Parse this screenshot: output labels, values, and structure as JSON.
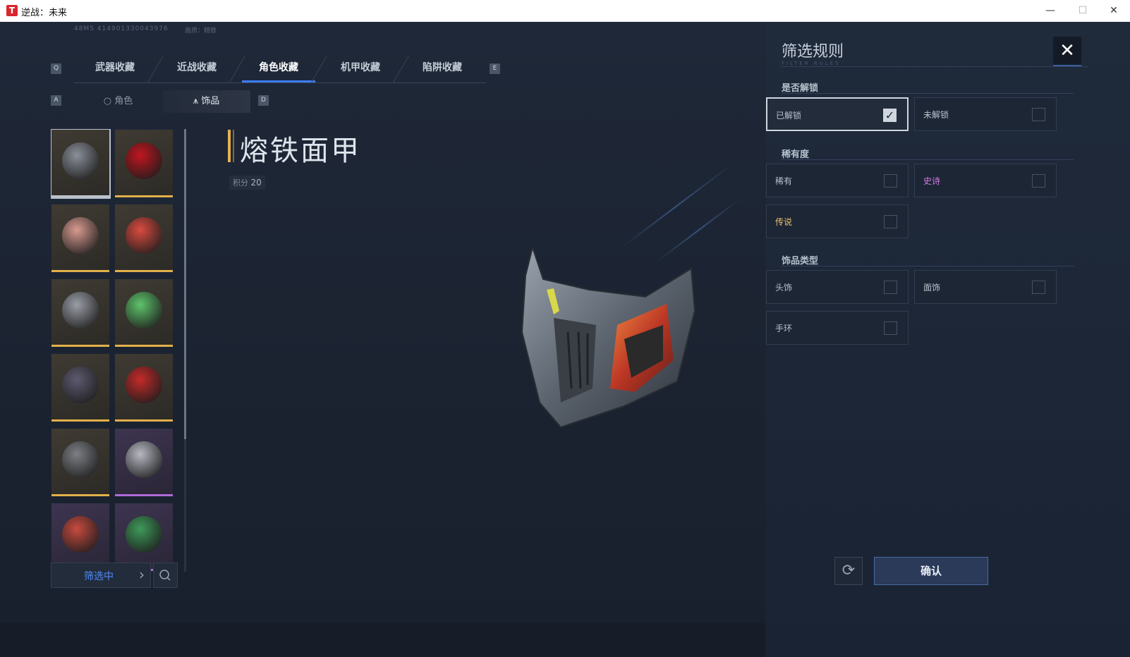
{
  "window": {
    "title": "逆战：未来",
    "app_icon_glyph": "T",
    "controls": [
      "—",
      "☐",
      "✕"
    ]
  },
  "header": {
    "ping_info": "48MS  414901330043976",
    "quality": "画质：精致"
  },
  "keys": {
    "prev_tab": "Q",
    "next_tab": "E",
    "prev_sub": "A",
    "next_sub": "D"
  },
  "tabs": [
    {
      "label": "武器收藏"
    },
    {
      "label": "近战收藏"
    },
    {
      "label": "角色收藏",
      "active": true
    },
    {
      "label": "机甲收藏"
    },
    {
      "label": "陷阱收藏"
    }
  ],
  "subtabs": [
    {
      "label": "角色",
      "icon": "head-icon"
    },
    {
      "label": "饰品",
      "icon": "ornament-icon",
      "active": true
    }
  ],
  "grid_items": [
    {
      "name": "mask-silver",
      "rarity_color": "#b9c1cb",
      "thumb_color": "#8a9099",
      "selected": true
    },
    {
      "name": "red-hood",
      "rarity_color": "#e2b04a",
      "thumb_color": "#c0161e"
    },
    {
      "name": "girl-head",
      "rarity_color": "#e2b04a",
      "thumb_color": "#d99a90"
    },
    {
      "name": "pig-head",
      "rarity_color": "#e2b04a",
      "thumb_color": "#d94b3f"
    },
    {
      "name": "wolf-head",
      "rarity_color": "#e2b04a",
      "thumb_color": "#9a9ea6"
    },
    {
      "name": "cat-headphones",
      "rarity_color": "#e2b04a",
      "thumb_color": "#5fc46b"
    },
    {
      "name": "visor",
      "rarity_color": "#e2b04a",
      "thumb_color": "#5d5a70"
    },
    {
      "name": "red-mask",
      "rarity_color": "#e2b04a",
      "thumb_color": "#c42a2a"
    },
    {
      "name": "bracelet",
      "rarity_color": "#e2b04a",
      "thumb_color": "#7d7f85"
    },
    {
      "name": "mecha-wing",
      "rarity_color": "#b06ad8",
      "thumb_color": "#b7b9c3"
    },
    {
      "name": "pig-hat",
      "rarity_color": "#b06ad8",
      "thumb_color": "#c84a3f"
    },
    {
      "name": "green-dragon",
      "rarity_color": "#b06ad8",
      "thumb_color": "#3e9a5a"
    }
  ],
  "filter_button": {
    "label": "筛选中",
    "chevron": "›"
  },
  "item": {
    "name": "熔铁面甲",
    "score_label": "积分",
    "score_value": "20"
  },
  "filter_panel": {
    "title": "筛选规则",
    "subtitle": "FILTER RULES",
    "close": "✕",
    "sections": [
      {
        "title": "是否解锁",
        "options": [
          {
            "label": "已解锁",
            "checked": true
          },
          {
            "label": "未解锁"
          }
        ]
      },
      {
        "title": "稀有度",
        "options": [
          {
            "label": "稀有",
            "color": "#c9d2dc"
          },
          {
            "label": "史诗",
            "color": "#d07ae6"
          },
          {
            "label": "传说",
            "color": "#e8c36a"
          }
        ]
      },
      {
        "title": "饰品类型",
        "options": [
          {
            "label": "头饰"
          },
          {
            "label": "面饰"
          },
          {
            "label": "手环"
          }
        ]
      }
    ],
    "refresh_icon": "⟳",
    "confirm": "确认"
  }
}
